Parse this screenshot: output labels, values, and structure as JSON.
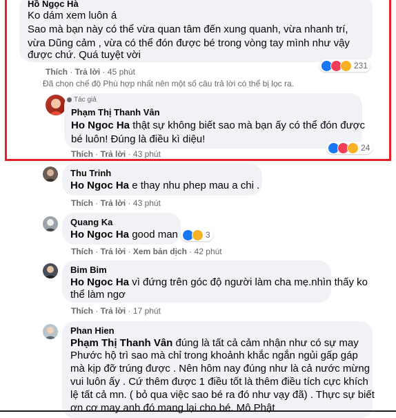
{
  "comments": [
    {
      "author": "Hồ Ngọc Hà",
      "lines": [
        "Ko dám xem luôn á",
        "Sao mà bạn này có thể vừa quan tâm đến xung quanh, vừa nhanh trí,",
        "vừa Dũng cảm , vừa có thể đón được bé trong vòng tay mình như vậy",
        "được chứ. Quá tuyệt vời"
      ],
      "like": "Thích",
      "reply": "Trả lời",
      "time": "45 phút",
      "reactions": "231"
    },
    {
      "notice": "Đã chọn chế độ Phù hợp nhất nên một số câu trả lời có thể bị lọc ra."
    },
    {
      "badge": "Tác giả",
      "author": "Phạm Thị Thanh Vân",
      "mention": "Ho Ngoc Ha",
      "line1": "thật sự không biết sao mà bạn ấy có thể đón được",
      "line2": "bé luôn! Đúng là điều kì diệu!",
      "like": "Thích",
      "reply": "Trả lời",
      "time": "43 phút",
      "reactions": "24"
    },
    {
      "author": "Thu Trinh",
      "mention": "Ho Ngoc Ha",
      "text": "e thay nhu phep mau a chi .",
      "like": "Thích",
      "reply": "Trả lời",
      "time": "43 phút"
    },
    {
      "author": "Quang Ka",
      "mention": "Ho Ngoc Ha",
      "text": "good man",
      "reactions": "3",
      "like": "Thích",
      "reply": "Trả lời",
      "translate": "Xem bản dịch",
      "time": "42 phút"
    },
    {
      "author": "Bim Bim",
      "mention": "Ho Ngoc Ha",
      "line1": "vì đứng trên góc độ người làm cha mẹ.nhìn thấy ko",
      "line2": "thể làm ngơ",
      "like": "Thích",
      "reply": "Trả lời",
      "time": "17 phút"
    },
    {
      "author": "Phan Hien",
      "mention": "Phạm Thị Thanh Vân",
      "line1": "đúng là tất cả cảm nhận như có sự may",
      "lines": [
        "Phước hộ trì sao mà chỉ trong khoảnh khắc ngắn ngủi gấp gáp",
        "mà kịp đỡ trúng được . Nên hôm nay đúng như là cả nước mừng",
        "vui luôn ấy . Cứ thêm được 1 điều tốt là thêm điều tích cực khích",
        "lệ tất cả mn. ( bỏ qua việc sao bé ra đó như vạy đã) . Thực sự biết",
        "ơn cơ may anh đó mang lại cho bé. Mô Phật"
      ]
    }
  ],
  "colors": {
    "highlight": "#e5202a",
    "bubble": "#f0f2f5",
    "meta": "#65676b",
    "like": "#1877f2",
    "love": "#f33e58",
    "wow": "#f7b125"
  }
}
